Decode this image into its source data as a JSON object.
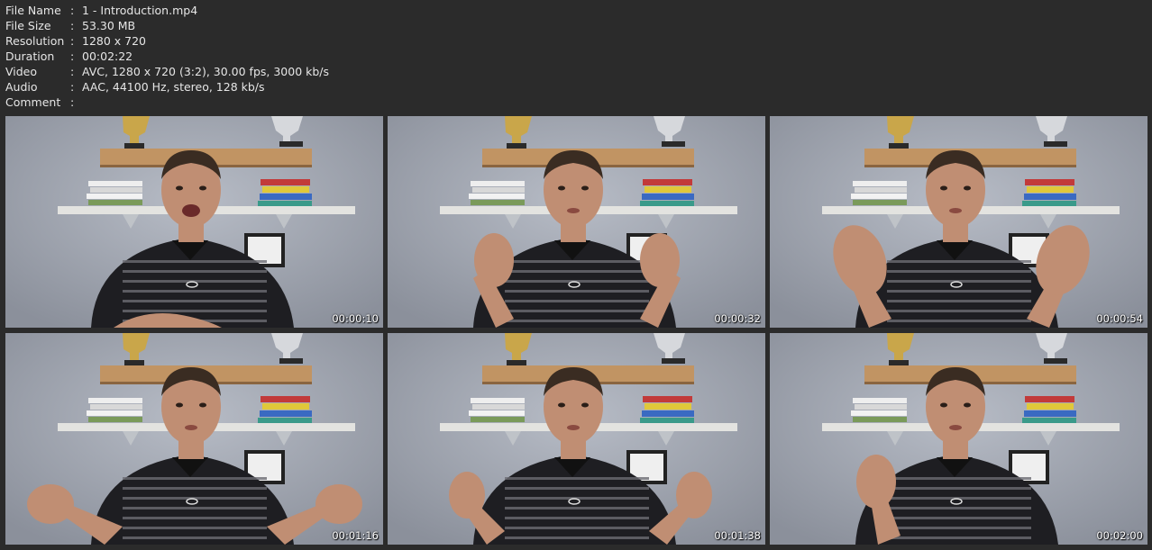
{
  "info": {
    "rows": [
      {
        "key": "File Name",
        "sep": ":",
        "value": "1 - Introduction.mp4"
      },
      {
        "key": "File Size",
        "sep": ":",
        "value": "53.30 MB"
      },
      {
        "key": "Resolution",
        "sep": ":",
        "value": "1280 x 720"
      },
      {
        "key": "Duration",
        "sep": ":",
        "value": "00:02:22"
      },
      {
        "key": "Video",
        "sep": ":",
        "value": "AVC, 1280 x 720 (3:2), 30.00 fps, 3000 kb/s"
      },
      {
        "key": "Audio",
        "sep": ":",
        "value": "AAC, 44100 Hz, stereo, 128 kb/s"
      },
      {
        "key": "Comment",
        "sep": ":",
        "value": ""
      }
    ]
  },
  "thumbnails": [
    {
      "time": "00:00:10",
      "pose": "mouth-open"
    },
    {
      "time": "00:00:32",
      "pose": "hands-raised"
    },
    {
      "time": "00:00:54",
      "pose": "hands-spread"
    },
    {
      "time": "00:01:16",
      "pose": "hands-out"
    },
    {
      "time": "00:01:38",
      "pose": "hands-pointing"
    },
    {
      "time": "00:02:00",
      "pose": "one-hand"
    }
  ],
  "colors": {
    "background": "#2b2b2b",
    "text": "#e6e6e6",
    "wall": "#a4a9b4",
    "shelf": "#e3e3e0",
    "shirt": "#1e1e22",
    "skin": "#c08e73"
  }
}
